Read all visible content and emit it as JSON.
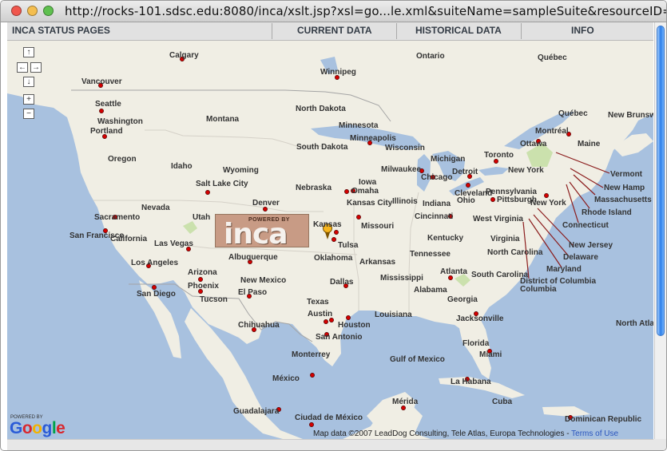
{
  "browser": {
    "url": "http://rocks-101.sdsc.edu:8080/inca/xslt.jsp?xsl=go...le.xml&suiteName=sampleSuite&resourceID=defaultGrid"
  },
  "nav": {
    "title": "INCA STATUS PAGES",
    "current_data": "CURRENT DATA",
    "historical_data": "HISTORICAL DATA",
    "info": "INFO"
  },
  "map_controls": {
    "up": "↑",
    "left": "←",
    "right": "→",
    "down": "↓",
    "zoom_in": "+",
    "zoom_out": "−"
  },
  "inca_logo": {
    "powered": "POWERED BY",
    "name": "inca"
  },
  "google_logo": {
    "powered": "POWERED BY",
    "name": "Google"
  },
  "attribution": {
    "copyright": "Map data ©2007 LeadDog Consulting, Tele Atlas, Europa Technologies -",
    "terms": "Terms of Use"
  },
  "labels": [
    "Calgary",
    "Ontario",
    "Québec",
    "Winnipeg",
    "Vancouver",
    "Seattle",
    "North Dakota",
    "Montana",
    "Washington",
    "Minnesota",
    "New Brunswick",
    "Montréal",
    "Québec",
    "Portland",
    "South Dakota",
    "Minneapolis",
    "Wisconsin",
    "Ottawa",
    "Maine",
    "Oregon",
    "Idaho",
    "Wyoming",
    "Michigan",
    "Toronto",
    "New York",
    "Vermont",
    "Salt Lake City",
    "Nebraska",
    "Iowa",
    "Omaha",
    "Chicago",
    "Milwaukee",
    "Detroit",
    "New Hamp",
    "Massachusetts",
    "Rhode Island",
    "Connecticut",
    "Nevada",
    "Denver",
    "Kansas City",
    "Illinois",
    "Indiana",
    "Ohio",
    "Cleveland",
    "Pennsylvania",
    "Pittsburgh",
    "New York",
    "New Jersey",
    "Delaware",
    "Maryland",
    "District of Columbia",
    "Sacramento",
    "San Francisco",
    "California",
    "Utah",
    "Kansas",
    "Missouri",
    "Cincinnati",
    "West Virginia",
    "Virginia",
    "Las Vegas",
    "Tulsa",
    "Kentucky",
    "Los Angeles",
    "Arizona",
    "Albuquerque",
    "New Mexico",
    "Oklahoma",
    "Arkansas",
    "Tennessee",
    "North Carolina",
    "Phoenix",
    "San Diego",
    "Tucson",
    "El Paso",
    "Dallas",
    "Mississippi",
    "Alabama",
    "Atlanta",
    "South Carolina",
    "Texas",
    "Austin",
    "Louisiana",
    "Georgia",
    "Chihuahua",
    "San Antonio",
    "Houston",
    "Jacksonville",
    "North Atlantic Ocean",
    "Monterrey",
    "Gulf of Mexico",
    "Florida",
    "Miami",
    "México",
    "La Habana",
    "Cuba",
    "Guadalajara",
    "Ciudad de México",
    "Mérida",
    "Dominican Republic"
  ]
}
